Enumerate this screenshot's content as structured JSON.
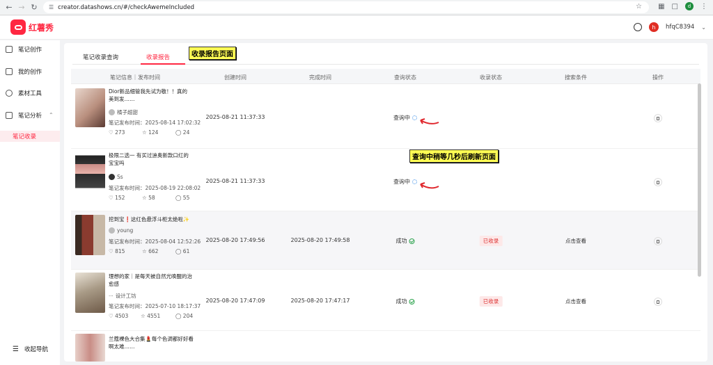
{
  "browser": {
    "url": "creator.datashows.cn/#/checkAwemeIncluded",
    "profile_initial": "d"
  },
  "app": {
    "logo_text": "红薯秀",
    "user_initial": "h",
    "username": "hfqC8394",
    "brand_color": "#ff2741"
  },
  "sidebar": {
    "items": [
      {
        "label": "笔记创作",
        "icon": "pen-icon"
      },
      {
        "label": "我的创作",
        "icon": "document-icon"
      },
      {
        "label": "素材工具",
        "icon": "gear-icon"
      },
      {
        "label": "笔记分析",
        "icon": "chart-icon"
      }
    ],
    "sub_item": "笔记收录",
    "collapse_label": "收起导航"
  },
  "tabs": [
    {
      "label": "笔记收录查询",
      "active": false
    },
    {
      "label": "收录报告",
      "active": true
    }
  ],
  "annotations": {
    "tab_note": "收录报告页面",
    "status_note": "查询中稍等几秒后刷新页面"
  },
  "table": {
    "headers": [
      "笔记信息｜发布时间",
      "创建时间",
      "完成时间",
      "查询状态",
      "收录状态",
      "搜索条件",
      "操作"
    ],
    "rows": [
      {
        "title": "Dior新品细管我先试为敬！！真的美到发……",
        "author": "橘子超甜",
        "pub_time": "笔记发布时间：2025-08-14 17:02:32",
        "likes": "273",
        "stars": "124",
        "comments": "24",
        "created": "2025-08-21 11:37:33",
        "finished": "",
        "query_status": "查询中",
        "include_status": "",
        "search_cond": ""
      },
      {
        "title": "极限二选一 有买过迪奥新款口红的宝宝吗",
        "author": "Ss",
        "pub_time": "笔记发布时间：2025-08-19 22:08:02",
        "likes": "152",
        "stars": "58",
        "comments": "55",
        "created": "2025-08-21 11:37:33",
        "finished": "",
        "query_status": "查询中",
        "include_status": "",
        "search_cond": ""
      },
      {
        "title": "挖到宝❗️这红色悬浮斗柜太绝啦✨",
        "author": "young",
        "pub_time": "笔记发布时间：2025-08-04 12:52:26",
        "likes": "815",
        "stars": "662",
        "comments": "61",
        "created": "2025-08-20 17:49:56",
        "finished": "2025-08-20 17:49:58",
        "query_status": "成功",
        "include_status": "已收录",
        "search_cond": "点击查看"
      },
      {
        "title": "理想的家｜是每天被自然光唤醒的治愈感",
        "author": "设计工坊",
        "pub_time": "笔记发布时间：2025-07-10 18:17:37",
        "likes": "4503",
        "stars": "4551",
        "comments": "204",
        "created": "2025-08-20 17:47:09",
        "finished": "2025-08-20 17:47:17",
        "query_status": "成功",
        "include_status": "已收录",
        "search_cond": "点击查看"
      },
      {
        "title": "兰蔻裸色大合集💄每个色调都好好看啊太难……",
        "author": "",
        "pub_time": "",
        "likes": "",
        "stars": "",
        "comments": "",
        "created": "",
        "finished": "",
        "query_status": "",
        "include_status": "",
        "search_cond": ""
      }
    ]
  }
}
